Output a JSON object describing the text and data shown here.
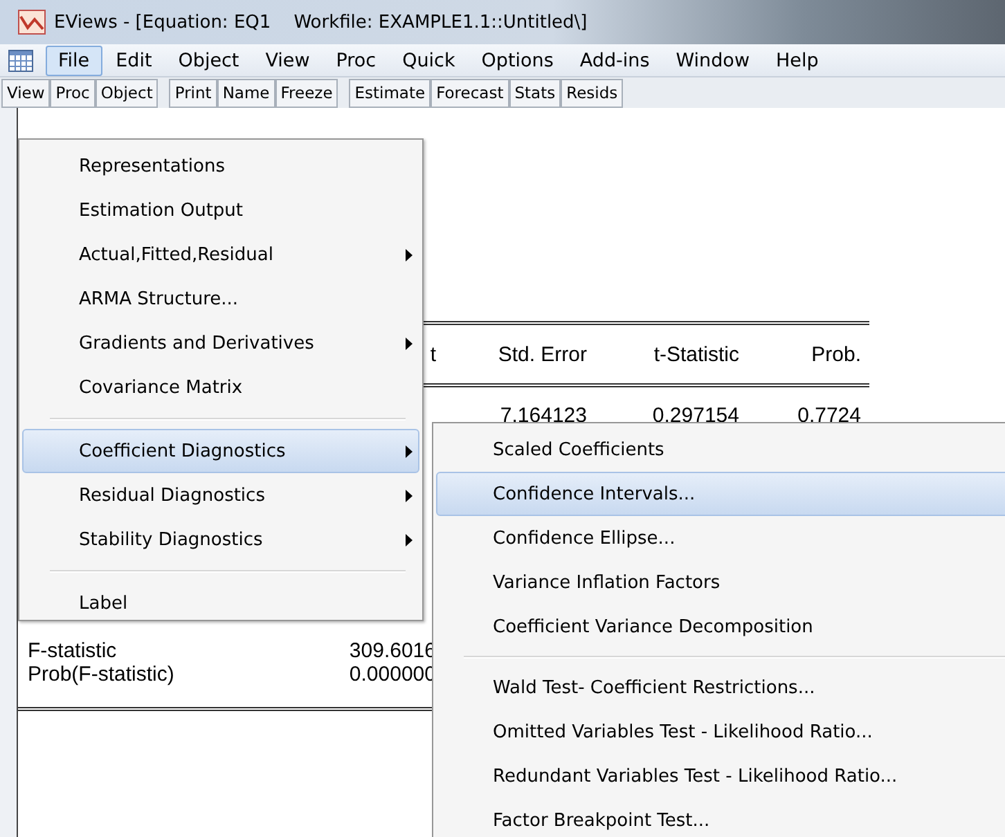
{
  "window": {
    "title": "EViews - [Equation: EQ1    Workfile: EXAMPLE1.1::Untitled\\]"
  },
  "menu_bar": [
    {
      "label": "File",
      "selected": true
    },
    {
      "label": "Edit",
      "selected": false
    },
    {
      "label": "Object",
      "selected": false
    },
    {
      "label": "View",
      "selected": false
    },
    {
      "label": "Proc",
      "selected": false
    },
    {
      "label": "Quick",
      "selected": false
    },
    {
      "label": "Options",
      "selected": false
    },
    {
      "label": "Add-ins",
      "selected": false
    },
    {
      "label": "Window",
      "selected": false
    },
    {
      "label": "Help",
      "selected": false
    }
  ],
  "toolbar": [
    [
      "View",
      "Proc",
      "Object"
    ],
    [
      "Print",
      "Name",
      "Freeze"
    ],
    [
      "Estimate",
      "Forecast",
      "Stats",
      "Resids"
    ]
  ],
  "results": {
    "columns": [
      "t",
      "Std. Error",
      "t-Statistic",
      "Prob."
    ],
    "row": [
      "7.164123",
      "0.297154",
      "0.7724"
    ],
    "stats": [
      {
        "label": "F-statistic",
        "value": "309.6016"
      },
      {
        "label": "Prob(F-statistic)",
        "value": "0.000000"
      }
    ]
  },
  "view_menu": [
    {
      "kind": "item",
      "label": "Representations",
      "submenu": false,
      "selected": false
    },
    {
      "kind": "item",
      "label": "Estimation Output",
      "submenu": false,
      "selected": false
    },
    {
      "kind": "item",
      "label": "Actual,Fitted,Residual",
      "submenu": true,
      "selected": false
    },
    {
      "kind": "item",
      "label": "ARMA Structure...",
      "submenu": false,
      "selected": false
    },
    {
      "kind": "item",
      "label": "Gradients and Derivatives",
      "submenu": true,
      "selected": false
    },
    {
      "kind": "item",
      "label": "Covariance Matrix",
      "submenu": false,
      "selected": false
    },
    {
      "kind": "separator"
    },
    {
      "kind": "item",
      "label": "Coefficient Diagnostics",
      "submenu": true,
      "selected": true
    },
    {
      "kind": "item",
      "label": "Residual Diagnostics",
      "submenu": true,
      "selected": false
    },
    {
      "kind": "item",
      "label": "Stability Diagnostics",
      "submenu": true,
      "selected": false
    },
    {
      "kind": "separator"
    },
    {
      "kind": "item",
      "label": "Label",
      "submenu": false,
      "selected": false
    }
  ],
  "submenu": [
    {
      "kind": "item",
      "label": "Scaled Coefficients",
      "selected": false
    },
    {
      "kind": "item",
      "label": "Confidence Intervals...",
      "selected": true
    },
    {
      "kind": "item",
      "label": "Confidence Ellipse...",
      "selected": false
    },
    {
      "kind": "item",
      "label": "Variance Inflation Factors",
      "selected": false
    },
    {
      "kind": "item",
      "label": "Coefficient Variance Decomposition",
      "selected": false
    },
    {
      "kind": "separator"
    },
    {
      "kind": "item",
      "label": "Wald Test- Coefficient Restrictions...",
      "selected": false
    },
    {
      "kind": "item",
      "label": "Omitted Variables Test - Likelihood Ratio...",
      "selected": false
    },
    {
      "kind": "item",
      "label": "Redundant Variables Test - Likelihood Ratio...",
      "selected": false
    },
    {
      "kind": "item",
      "label": "Factor Breakpoint Test...",
      "selected": false
    }
  ]
}
